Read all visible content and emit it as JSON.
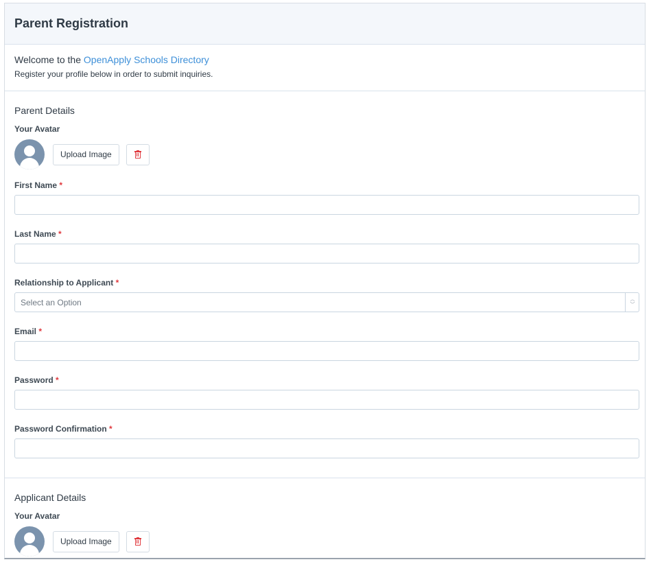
{
  "header": {
    "title": "Parent Registration"
  },
  "welcome": {
    "prefix": "Welcome to the",
    "link_text": "OpenApply Schools Directory",
    "subtitle": "Register your profile below in order to submit inquiries."
  },
  "parent_section": {
    "title": "Parent Details",
    "avatar_label": "Your Avatar",
    "upload_label": "Upload Image",
    "fields": {
      "first_name": {
        "label": "First Name",
        "required": "*",
        "value": ""
      },
      "last_name": {
        "label": "Last Name",
        "required": "*",
        "value": ""
      },
      "relationship": {
        "label": "Relationship to Applicant",
        "required": "*",
        "placeholder": "Select an Option"
      },
      "email": {
        "label": "Email",
        "required": "*",
        "value": ""
      },
      "password": {
        "label": "Password",
        "required": "*",
        "value": ""
      },
      "password_confirmation": {
        "label": "Password Confirmation",
        "required": "*",
        "value": ""
      }
    }
  },
  "applicant_section": {
    "title": "Applicant Details",
    "avatar_label": "Your Avatar",
    "upload_label": "Upload Image"
  },
  "colors": {
    "link": "#3d8fd8",
    "required": "#e0393e",
    "avatar": "#7b93ad",
    "header_bg": "#f4f7fb"
  },
  "icons": {
    "avatar": "user-avatar-icon",
    "delete": "trash-icon",
    "select": "chevron-updown-icon"
  }
}
